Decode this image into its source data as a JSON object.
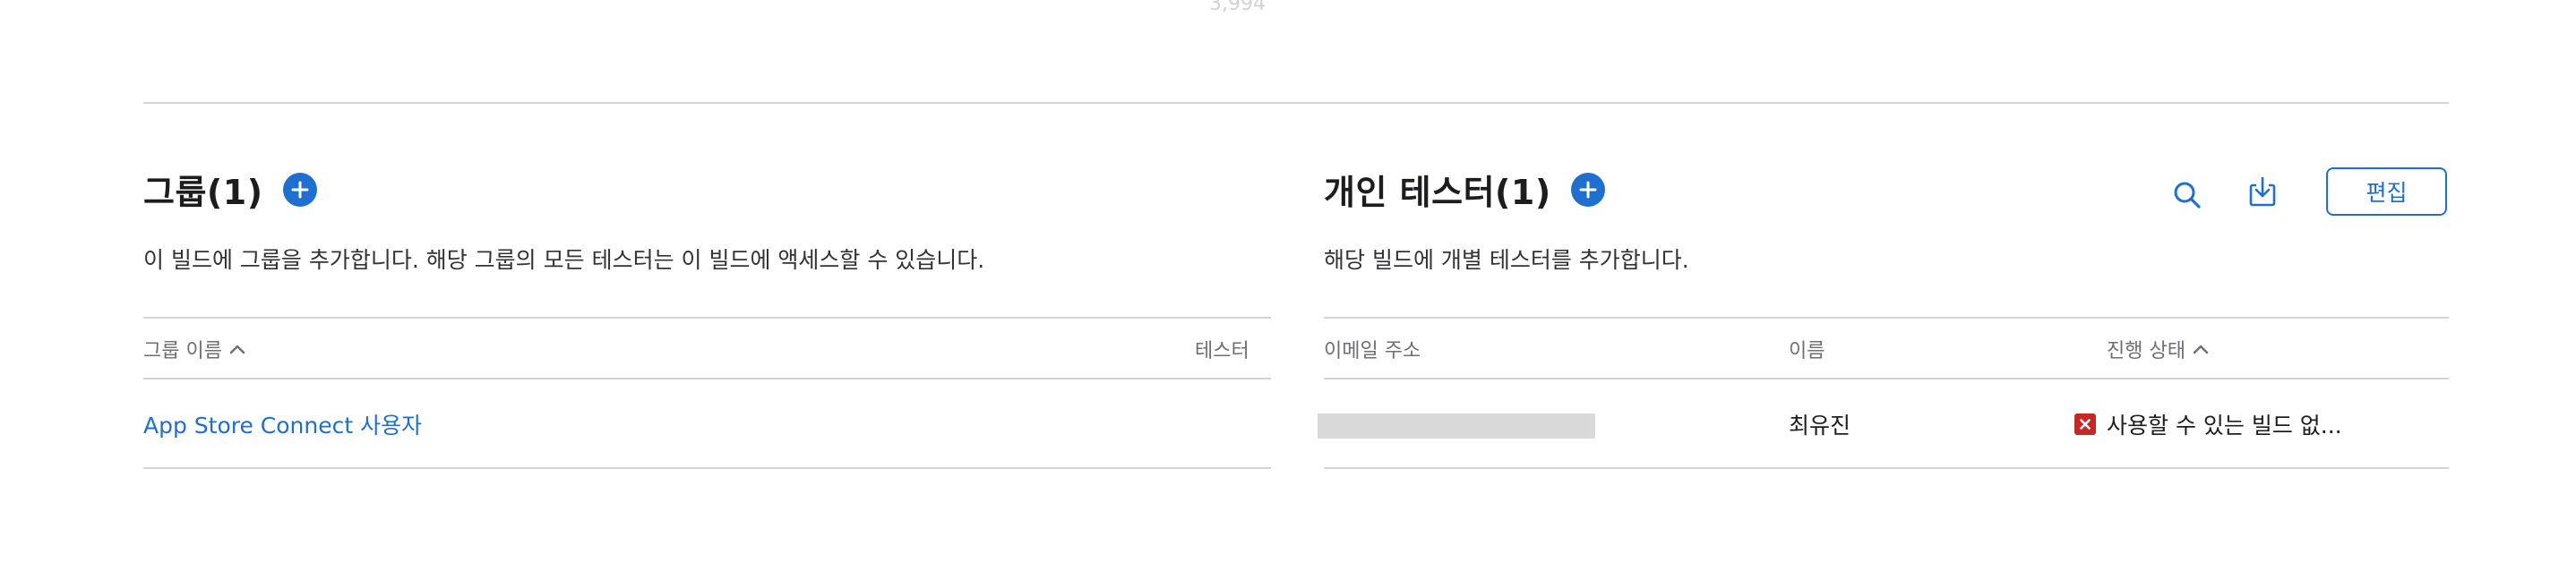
{
  "top": {
    "faded_count": "3,994"
  },
  "groups": {
    "title": "그룹(1)",
    "description": "이 빌드에 그룹을 추가합니다. 해당 그룹의 모든 테스터는 이 빌드에 액세스할 수 있습니다.",
    "columns": {
      "name": "그룹 이름",
      "testers": "테스터"
    },
    "rows": [
      {
        "name": "App Store Connect 사용자",
        "testers": ""
      }
    ]
  },
  "individual": {
    "title": "개인 테스터(1)",
    "description": "해당 빌드에 개별 테스터를 추가합니다.",
    "edit_label": "편집",
    "columns": {
      "email": "이메일 주소",
      "name": "이름",
      "status": "진행 상태"
    },
    "rows": [
      {
        "email": "",
        "name": "최유진",
        "status": "사용할 수 있는 빌드 없..."
      }
    ]
  },
  "colors": {
    "accent": "#1f6fd0",
    "error": "#c62828",
    "divider": "#d2d2d7"
  },
  "icons": [
    "add-icon",
    "chevron-up-icon",
    "search-icon",
    "download-icon",
    "error-x-icon"
  ]
}
